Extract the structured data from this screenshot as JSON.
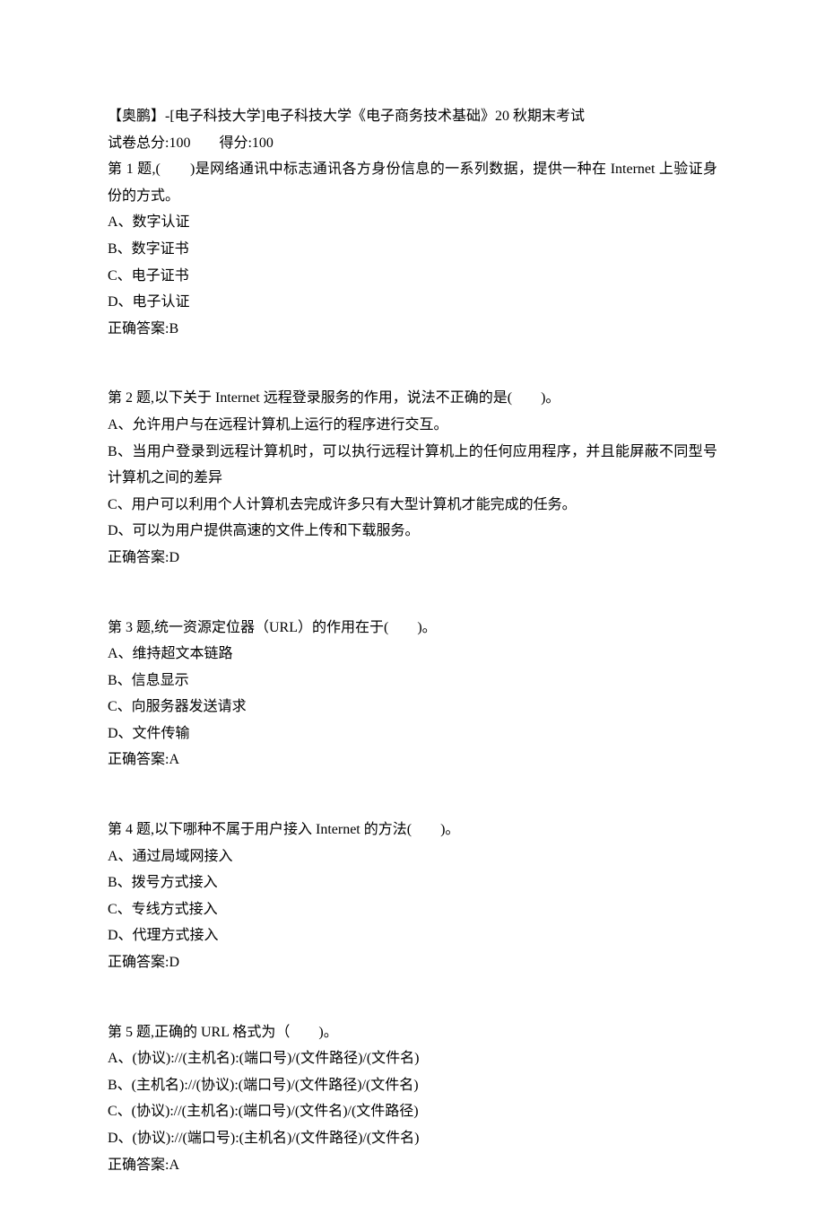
{
  "header": {
    "title": "【奥鹏】-[电子科技大学]电子科技大学《电子商务技术基础》20 秋期末考试",
    "score_label": "试卷总分:",
    "score_total": "100",
    "got_label": "得分:",
    "score_got": "100"
  },
  "questions": [
    {
      "prompt": "第 1 题,(　　)是网络通讯中标志通讯各方身份信息的一系列数据，提供一种在 Internet 上验证身份的方式。",
      "options": [
        "A、数字认证",
        "B、数字证书",
        "C、电子证书",
        "D、电子认证"
      ],
      "answer": "正确答案:B"
    },
    {
      "prompt": "第 2 题,以下关于 Internet 远程登录服务的作用，说法不正确的是(　　)。",
      "options": [
        "A、允许用户与在远程计算机上运行的程序进行交互。",
        "B、当用户登录到远程计算机时，可以执行远程计算机上的任何应用程序，并且能屏蔽不同型号计算机之间的差异",
        "C、用户可以利用个人计算机去完成许多只有大型计算机才能完成的任务。",
        "D、可以为用户提供高速的文件上传和下载服务。"
      ],
      "answer": "正确答案:D"
    },
    {
      "prompt": "第 3 题,统一资源定位器（URL）的作用在于(　　)。",
      "options": [
        "A、维持超文本链路",
        "B、信息显示",
        "C、向服务器发送请求",
        "D、文件传输"
      ],
      "answer": "正确答案:A"
    },
    {
      "prompt": "第 4 题,以下哪种不属于用户接入 Internet 的方法(　　)。",
      "options": [
        "A、通过局域网接入",
        "B、拨号方式接入",
        "C、专线方式接入",
        "D、代理方式接入"
      ],
      "answer": "正确答案:D"
    },
    {
      "prompt": "第 5 题,正确的 URL 格式为（　　)。",
      "options": [
        "A、(协议)://(主机名):(端口号)/(文件路径)/(文件名)",
        "B、(主机名)://(协议):(端口号)/(文件路径)/(文件名)",
        "C、(协议)://(主机名):(端口号)/(文件名)/(文件路径)",
        "D、(协议)://(端口号):(主机名)/(文件路径)/(文件名)"
      ],
      "answer": "正确答案:A"
    }
  ]
}
